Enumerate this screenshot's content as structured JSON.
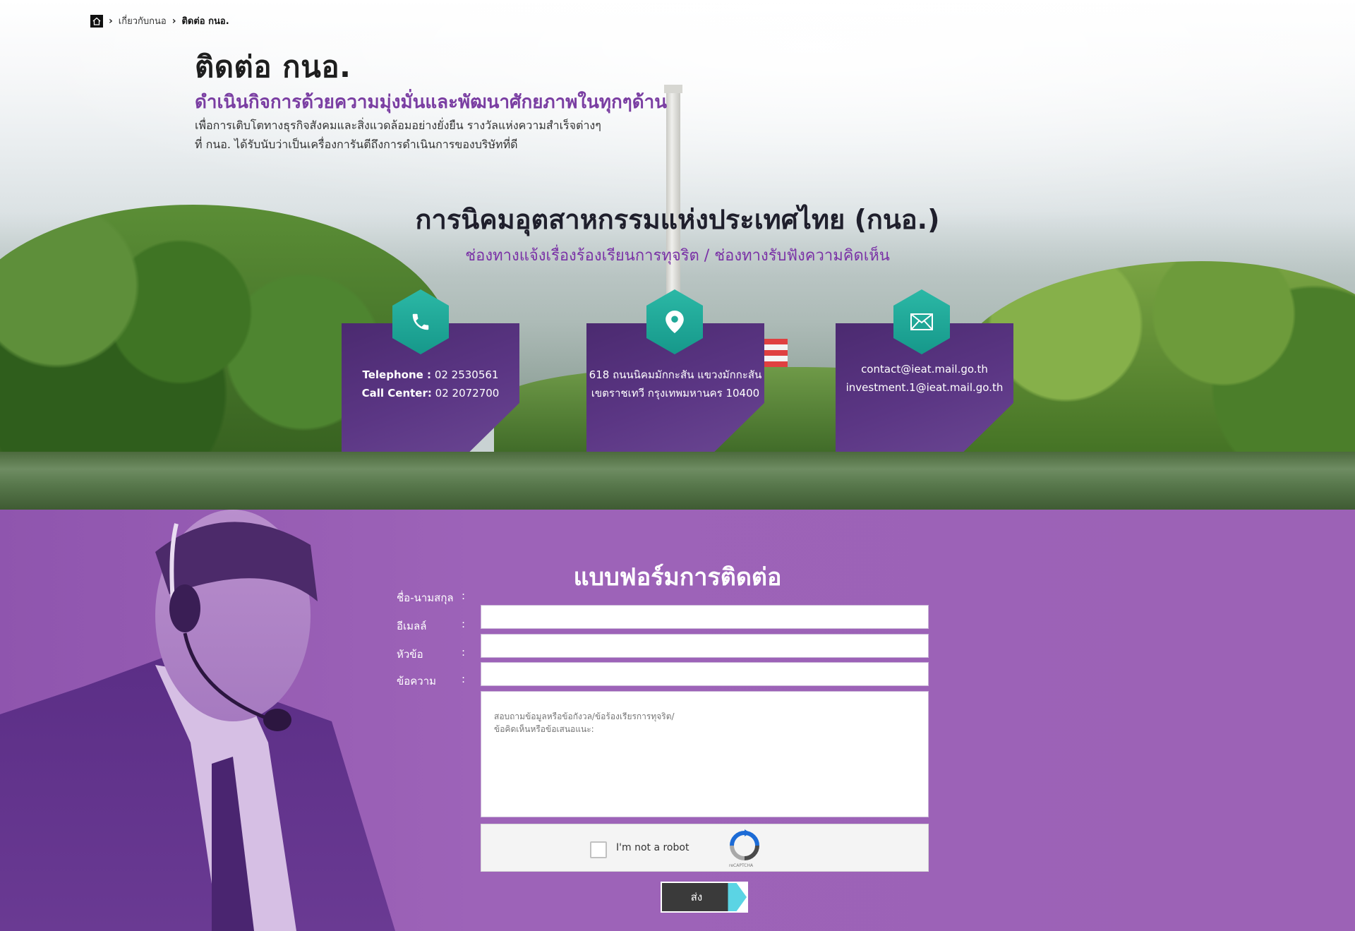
{
  "breadcrumb": {
    "items": [
      "เกี่ยวกับกนอ",
      "ติดต่อ กนอ."
    ]
  },
  "header": {
    "title": "ติดต่อ กนอ.",
    "subtitle": "ดำเนินกิจการด้วยความมุ่งมั่นและพัฒนาศักยภาพในทุกๆด้าน",
    "description_lines": [
      "เพื่อการเติบโตทางธุรกิจสังคมและสิ่งแวดล้อมอย่างยั่งยืน รางวัลแห่งความสำเร็จต่างๆ",
      "ที่ กนอ. ได้รับนับว่าเป็นเครื่องการันตีถึงการดำเนินการของบริษัทที่ดี"
    ]
  },
  "organization": {
    "name": "การนิคมอุตสาหกรรมแห่งประเทศไทย (กนอ.)",
    "channels": "ช่องทางแจ้งเรื่องร้องเรียนการทุจริต /  ช่องทางรับฟังความคิดเห็น"
  },
  "contact_cards": {
    "phone": {
      "icon": "phone-icon",
      "telephone_label": "Telephone :",
      "telephone_value": "02 2530561",
      "callcenter_label": "Call Center:",
      "callcenter_value": "02 2072700"
    },
    "address": {
      "icon": "location-pin-icon",
      "line1": "618 ถนนนิคมมักกะสัน แขวงมักกะสัน",
      "line2": "เขตราชเทวี กรุงเทพมหานคร 10400"
    },
    "email": {
      "icon": "envelope-icon",
      "line1": "contact@ieat.mail.go.th",
      "line2": "investment.1@ieat.mail.go.th"
    }
  },
  "form": {
    "title": "แบบฟอร์มการติดต่อ",
    "fields": {
      "name": {
        "label": "ชื่อ-นามสกุล",
        "value": ""
      },
      "email": {
        "label": "อีเมลล์",
        "value": ""
      },
      "subject": {
        "label": "หัวข้อ",
        "value": ""
      },
      "message": {
        "label": "ข้อความ",
        "placeholder": "สอบถามข้อมูลหรือข้อกังวล/ข้อร้องเรียรการทุจริต/\nข้อคิดเห็นหรือข้อเสนอแนะ:"
      }
    },
    "colon": ":",
    "recaptcha": {
      "label": "I'm not a robot",
      "brand": "reCAPTCHA"
    },
    "submit_label": "ส่ง"
  },
  "colors": {
    "purple_dark": "#4b2a70",
    "purple_form": "#9c62b6",
    "teal": "#1fa898",
    "cyan_accent": "#5bd4e4"
  }
}
